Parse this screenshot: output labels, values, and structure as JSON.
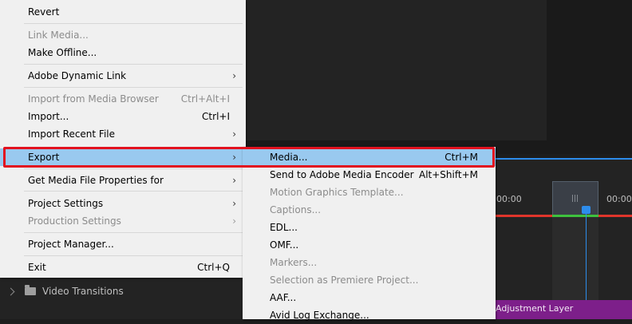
{
  "timeline": {
    "timestamp_left": "00:00",
    "timestamp_right": "00:00:",
    "clip_label": "Adjustment Layer",
    "work_area_handle": "|||"
  },
  "project_panel": {
    "video_transitions": "Video Transitions"
  },
  "file_menu": {
    "items": [
      {
        "label": "Revert",
        "shortcut": "",
        "submenu": false,
        "disabled": false
      },
      {
        "label": "Link Media...",
        "shortcut": "",
        "submenu": false,
        "disabled": true
      },
      {
        "label": "Make Offline...",
        "shortcut": "",
        "submenu": false,
        "disabled": false
      },
      {
        "label": "Adobe Dynamic Link",
        "shortcut": "",
        "submenu": true,
        "disabled": false
      },
      {
        "label": "Import from Media Browser",
        "shortcut": "Ctrl+Alt+I",
        "submenu": false,
        "disabled": true
      },
      {
        "label": "Import...",
        "shortcut": "Ctrl+I",
        "submenu": false,
        "disabled": false
      },
      {
        "label": "Import Recent File",
        "shortcut": "",
        "submenu": true,
        "disabled": false
      },
      {
        "label": "Export",
        "shortcut": "",
        "submenu": true,
        "disabled": false,
        "highlighted": true
      },
      {
        "label": "Get Media File Properties for",
        "shortcut": "",
        "submenu": true,
        "disabled": false
      },
      {
        "label": "Project Settings",
        "shortcut": "",
        "submenu": true,
        "disabled": false
      },
      {
        "label": "Production Settings",
        "shortcut": "",
        "submenu": true,
        "disabled": true
      },
      {
        "label": "Project Manager...",
        "shortcut": "",
        "submenu": false,
        "disabled": false
      },
      {
        "label": "Exit",
        "shortcut": "Ctrl+Q",
        "submenu": false,
        "disabled": false
      }
    ],
    "submenu_arrow": "›"
  },
  "export_menu": {
    "items": [
      {
        "label": "Media...",
        "shortcut": "Ctrl+M",
        "disabled": false,
        "highlighted": true
      },
      {
        "label": "Send to Adobe Media Encoder",
        "shortcut": "Alt+Shift+M",
        "disabled": false
      },
      {
        "label": "Motion Graphics Template...",
        "shortcut": "",
        "disabled": true
      },
      {
        "label": "Captions...",
        "shortcut": "",
        "disabled": true
      },
      {
        "label": "EDL...",
        "shortcut": "",
        "disabled": false
      },
      {
        "label": "OMF...",
        "shortcut": "",
        "disabled": false
      },
      {
        "label": "Markers...",
        "shortcut": "",
        "disabled": true
      },
      {
        "label": "Selection as Premiere Project...",
        "shortcut": "",
        "disabled": true
      },
      {
        "label": "AAF...",
        "shortcut": "",
        "disabled": false
      },
      {
        "label": "Avid Log Exchange...",
        "shortcut": "",
        "disabled": false
      }
    ]
  },
  "colors": {
    "menu_bg": "#f0f0f0",
    "highlight": "#99c9ef",
    "callout_red": "#e2121f",
    "timeline_red": "#e0352b",
    "playhead_blue": "#2d8ceb",
    "clip_purple": "#7d1f8a"
  }
}
